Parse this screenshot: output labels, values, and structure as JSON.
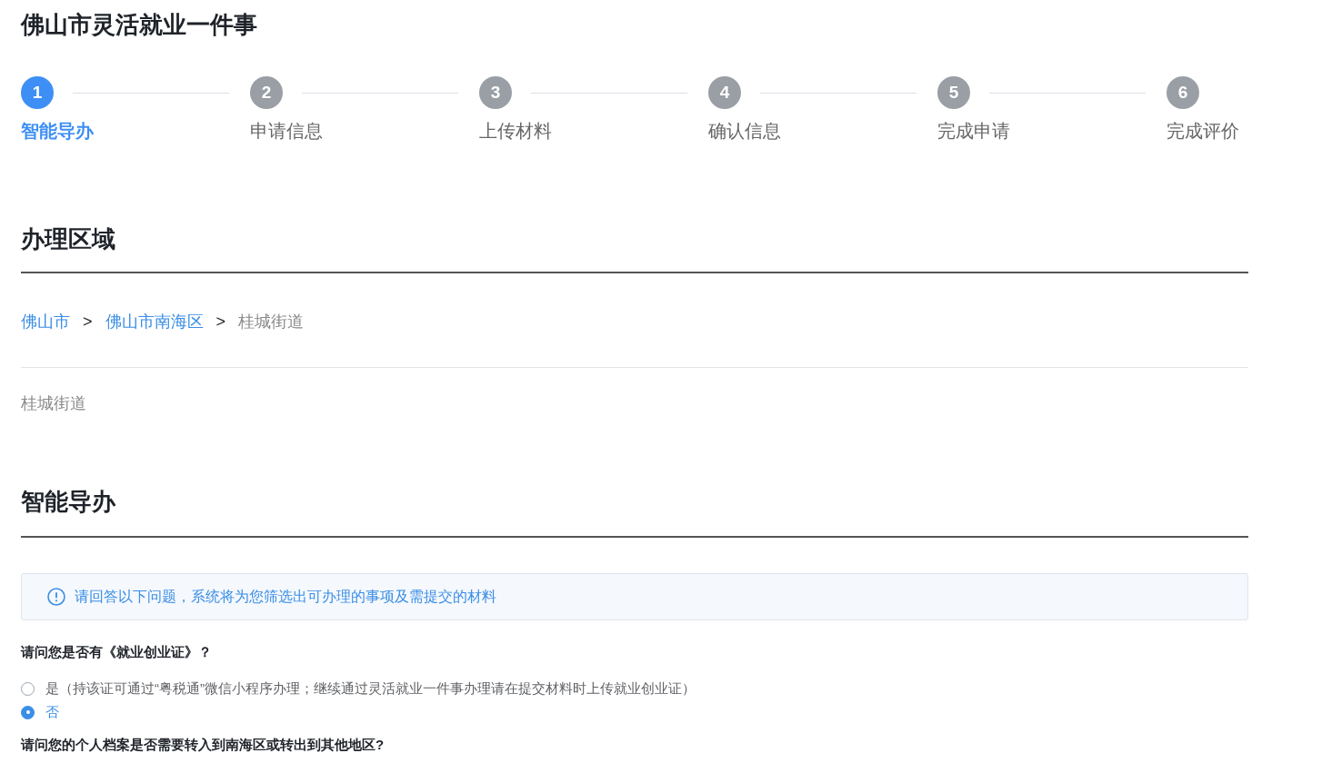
{
  "page": {
    "title": "佛山市灵活就业一件事"
  },
  "steps": [
    {
      "number": "1",
      "label": "智能导办",
      "selected": true
    },
    {
      "number": "2",
      "label": "申请信息",
      "selected": false
    },
    {
      "number": "3",
      "label": "上传材料",
      "selected": false
    },
    {
      "number": "4",
      "label": "确认信息",
      "selected": false
    },
    {
      "number": "5",
      "label": "完成申请",
      "selected": false
    },
    {
      "number": "6",
      "label": "完成评价",
      "selected": false
    }
  ],
  "region_section": {
    "heading": "办理区域",
    "breadcrumb": [
      {
        "kind": "link",
        "text": "佛山市"
      },
      {
        "kind": "separator",
        "text": ">"
      },
      {
        "kind": "link",
        "text": "佛山市南海区"
      },
      {
        "kind": "separator",
        "text": ">"
      },
      {
        "kind": "current",
        "text": "桂城街道"
      }
    ],
    "selected_region": "桂城街道"
  },
  "guide_section": {
    "heading": "智能导办",
    "notice": "请回答以下问题，系统将为您筛选出可办理的事项及需提交的材料",
    "questions": [
      {
        "text": "请问您是否有《就业创业证》？",
        "options": [
          {
            "label": "是（持该证可通过“粤税通”微信小程序办理；继续通过灵活就业一件事办理请在提交材料时上传就业创业证）",
            "selected": false
          },
          {
            "label": "否",
            "selected": true
          }
        ]
      },
      {
        "text": "请问您的个人档案是否需要转入到南海区或转出到其他地区?"
      }
    ]
  }
}
